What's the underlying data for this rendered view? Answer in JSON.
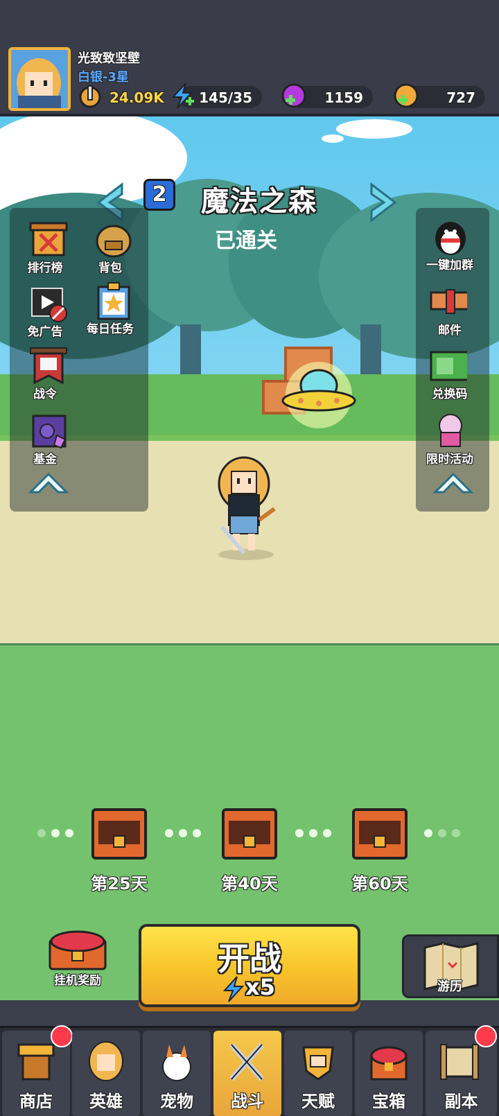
{
  "player": {
    "name": "光致致坚壁",
    "rank": "白银-3星"
  },
  "stats": {
    "power": "24.09K",
    "energy": "145/35",
    "gems": "1159",
    "gold": "727"
  },
  "stage": {
    "number": "2",
    "name": "魔法之森",
    "status": "已通关"
  },
  "left_menu": {
    "items": [
      "排行榜",
      "背包",
      "免广告",
      "每日任务",
      "战令",
      "基金"
    ]
  },
  "right_menu": {
    "items": [
      "一键加群",
      "邮件",
      "兑换码",
      "限时活动"
    ]
  },
  "rewards": {
    "days": [
      "第25天",
      "第40天",
      "第60天"
    ]
  },
  "actions": {
    "idle_reward": "挂机奖励",
    "fight": "开战",
    "fight_cost": "x5",
    "travel": "游历"
  },
  "bottom_nav": {
    "items": [
      "商店",
      "英雄",
      "宠物",
      "战斗",
      "天赋",
      "宝箱",
      "副本"
    ],
    "active": "战斗"
  },
  "colors": {
    "accent": "#f7c42a",
    "badge": "#ff3a4c",
    "rank": "#59a8ff"
  }
}
